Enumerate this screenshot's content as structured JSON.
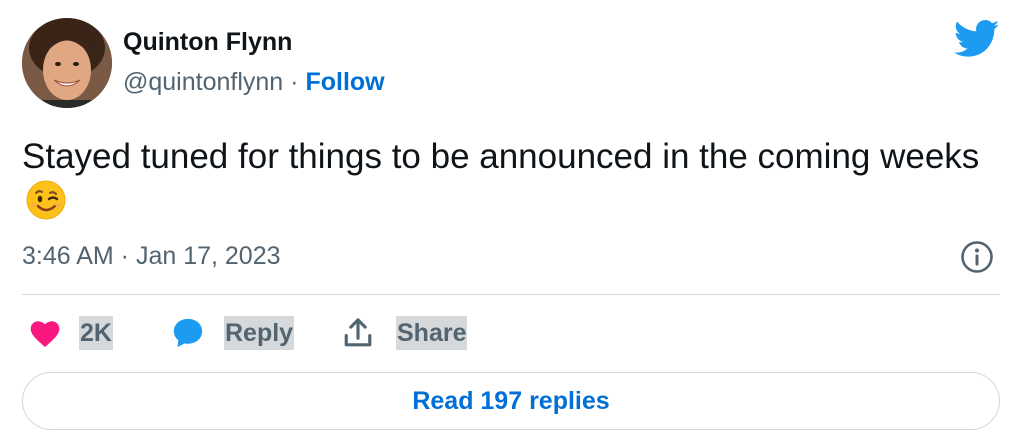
{
  "author": {
    "name": "Quinton Flynn",
    "handle": "@quintonflynn",
    "separator": "·",
    "follow_label": "Follow"
  },
  "tweet": {
    "text": "Stayed tuned for things to be announced in the coming weeks",
    "emoji_icon": "winking-face-emoji",
    "timestamp": "3:46 AM · Jan 17, 2023"
  },
  "actions": {
    "like_count": "2K",
    "reply_label": "Reply",
    "share_label": "Share"
  },
  "replies_button": {
    "label": "Read 197 replies"
  },
  "icons": {
    "brand": "twitter-bird-icon",
    "info": "info-icon",
    "like": "heart-icon",
    "reply": "speech-bubble-icon",
    "share": "share-upload-icon"
  },
  "colors": {
    "brand_blue": "#1d9bf0",
    "link_blue": "#006fd6",
    "like_pink": "#f91880",
    "muted_text": "#536471",
    "divider": "#cfd9de"
  }
}
